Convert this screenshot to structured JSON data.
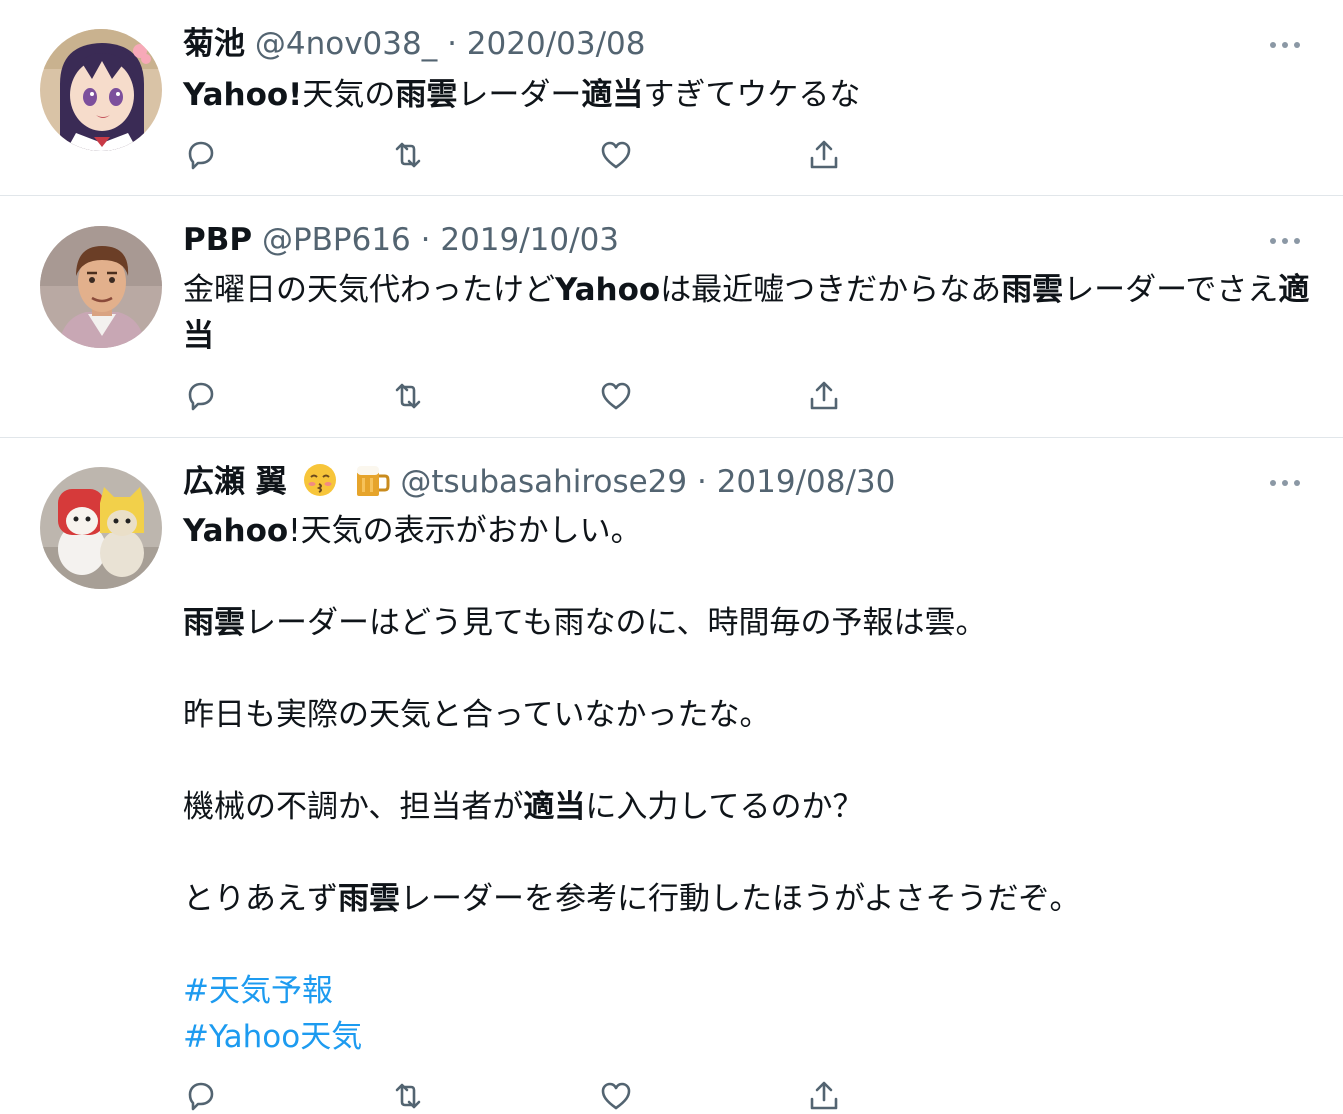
{
  "tweets": [
    {
      "name": "菊池",
      "handle": "@4nov038_",
      "separator": "·",
      "date": "2020/03/08",
      "body": [
        [
          {
            "t": "Yahoo!",
            "b": true
          },
          {
            "t": "天気の"
          },
          {
            "t": "雨雲",
            "b": true
          },
          {
            "t": "レーダー"
          },
          {
            "t": "適当",
            "b": true
          },
          {
            "t": "すぎてウケるな"
          }
        ]
      ],
      "avatar_icon": "anime-girl-avatar"
    },
    {
      "name": "PBP",
      "handle": "@PBP616",
      "separator": "·",
      "date": "2019/10/03",
      "body": [
        [
          {
            "t": "金曜日の天気代わったけど"
          },
          {
            "t": "Yahoo",
            "b": true
          },
          {
            "t": "は最近嘘つきだからなあ"
          },
          {
            "t": "雨雲",
            "b": true
          },
          {
            "t": "レーダーでさえ"
          },
          {
            "t": "適当",
            "b": true
          }
        ]
      ],
      "avatar_icon": "man-cartoon-avatar"
    },
    {
      "name": "広瀬 翼",
      "name_emojis": [
        "kissing-face-emoji",
        "beer-mug-emoji"
      ],
      "handle": "@tsubasahirose29",
      "separator": "·",
      "date": "2019/08/30",
      "body": [
        [
          {
            "t": "Yahoo",
            "b": true
          },
          {
            "t": "!天気の表示がおかしい。"
          }
        ],
        [],
        [
          {
            "t": "雨雲",
            "b": true
          },
          {
            "t": "レーダーはどう見ても雨なのに、時間毎の予報は雲。"
          }
        ],
        [],
        [
          {
            "t": "昨日も実際の天気と合っていなかったな。"
          }
        ],
        [],
        [
          {
            "t": "機械の不調か、担当者が"
          },
          {
            "t": "適当",
            "b": true
          },
          {
            "t": "に入力してるのか？"
          }
        ],
        [],
        [
          {
            "t": "とりあえず"
          },
          {
            "t": "雨雲",
            "b": true
          },
          {
            "t": "レーダーを参考に行動したほうがよさそうだぞ。"
          }
        ],
        []
      ],
      "hashtags": [
        "#天気予報",
        "#Yahoo天気"
      ],
      "avatar_icon": "plush-toys-avatar"
    }
  ],
  "actions": [
    "reply-icon",
    "retweet-icon",
    "like-icon",
    "share-icon"
  ],
  "more_icon": "more-options-icon",
  "colors": {
    "text": "#0f1419",
    "secondary": "#536471",
    "link": "#1d9bf0",
    "divider": "#e1e6ea"
  }
}
